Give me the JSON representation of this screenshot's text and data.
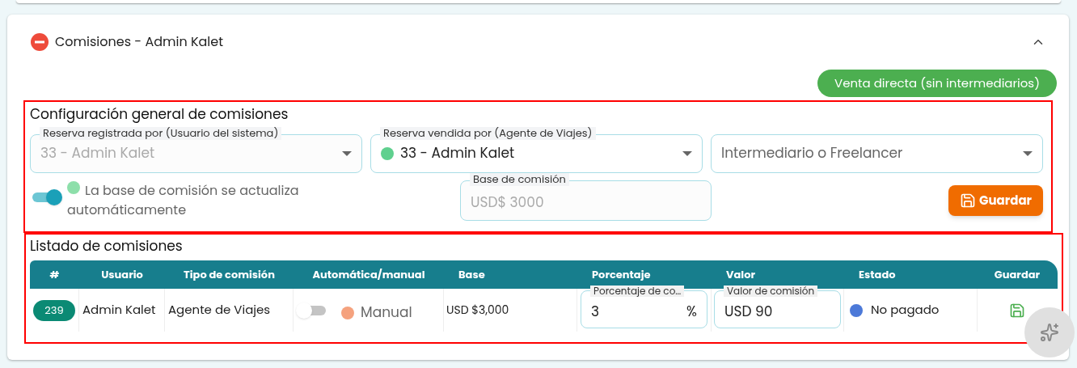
{
  "card": {
    "title": "Comisiones - Admin Kalet",
    "expanded": true
  },
  "direct_sale_button": "Venta directa (sin intermediarios)",
  "config": {
    "heading": "Configuración general de comisiones",
    "fields": [
      {
        "label": "Reserva registrada por (Usuario del sistema)",
        "value": "33 - Admin Kalet",
        "disabled": true
      },
      {
        "label": "Reserva vendida por (Agente de Viajes)",
        "value": "33 - Admin Kalet",
        "color": "#5fd08e",
        "disabled": false
      },
      {
        "placeholder": "Intermediario o Freelancer"
      }
    ],
    "auto_toggle": {
      "on": true,
      "color": "#8ddfaa",
      "label": "La base de comisión se actualiza automáticamente"
    },
    "base_field": {
      "label": "Base de comisión",
      "value": "USD$ 3000",
      "disabled": true
    },
    "save_button": "Guardar"
  },
  "list": {
    "heading": "Listado de comisiones",
    "columns": [
      "#",
      "Usuario",
      "Tipo de comisión",
      "Automática/manual",
      "Base",
      "Porcentaje",
      "Valor",
      "Estado",
      "Guardar"
    ],
    "rows": [
      {
        "id": "239",
        "user": "Admin Kalet",
        "type": "Agente de Viajes",
        "auto": false,
        "mode": {
          "label": "Manual",
          "color": "#f5a27e"
        },
        "base": "USD $3,000",
        "percent_label": "Porcentaje de co…",
        "percent": "3",
        "percent_suffix": "%",
        "value_label": "Valor de comisión",
        "value": "USD 90",
        "status": {
          "label": "No pagado",
          "color": "#4c79d8"
        }
      }
    ]
  }
}
